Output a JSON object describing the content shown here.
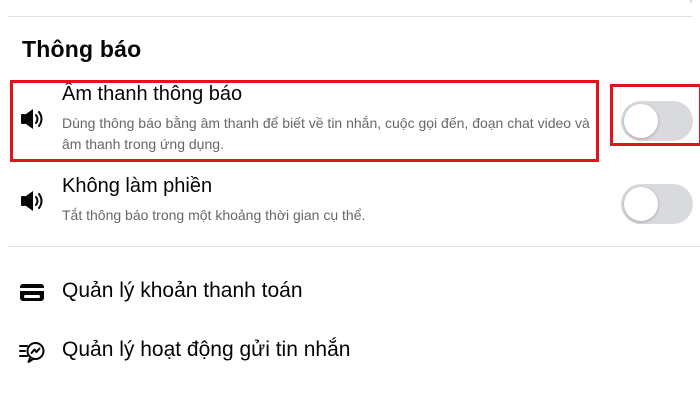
{
  "section": {
    "title": "Thông báo"
  },
  "settings": [
    {
      "title": "Âm thanh thông báo",
      "description": "Dùng thông báo bằng âm thanh để biết về tin nhắn, cuộc gọi đến, đoạn chat video và âm thanh trong ứng dụng.",
      "icon": "speaker-icon",
      "enabled": false
    },
    {
      "title": "Không làm phiền",
      "description": "Tắt thông báo trong một khoảng thời gian cụ thể.",
      "icon": "speaker-icon",
      "enabled": false
    }
  ],
  "menu": [
    {
      "label": "Quản lý khoản thanh toán",
      "icon": "credit-card-icon"
    },
    {
      "label": "Quản lý hoạt động gửi tin nhắn",
      "icon": "message-activity-icon"
    }
  ],
  "colors": {
    "highlight": "#e3131b",
    "toggle_off": "#d9dade",
    "divider": "#dcdee3",
    "secondary_text": "#65676b"
  }
}
